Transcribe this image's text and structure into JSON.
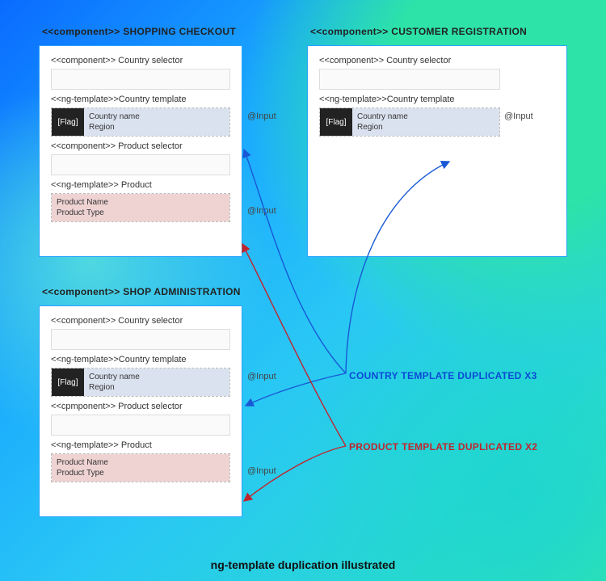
{
  "panels": {
    "p1": {
      "title": "<<component>> SHOPPING CHECKOUT",
      "country_selector_label": "<<component>> Country selector",
      "country_template_label": "<<ng-template>>Country template",
      "country_input_tag": "@Input",
      "flag_label": "[Flag]",
      "country_name": "Country name",
      "region": "Region",
      "product_selector_label": "<<component>> Product selector",
      "product_template_label": "<<ng-template>> Product",
      "product_input_tag": "@Input",
      "product_name": "Product Name",
      "product_type": "Product Type"
    },
    "p2": {
      "title": "<<component>> CUSTOMER REGISTRATION",
      "country_selector_label": "<<component>> Country selector",
      "country_template_label": "<<ng-template>>Country template",
      "country_input_tag": "@Input",
      "flag_label": "[Flag]",
      "country_name": "Country name",
      "region": "Region"
    },
    "p3": {
      "title": "<<component>> SHOP ADMINISTRATION",
      "country_selector_label": "<<component>> Country selector",
      "country_template_label": "<<ng-template>>Country template",
      "country_input_tag": "@Input",
      "flag_label": "[Flag]",
      "country_name": "Country name",
      "region": "Region",
      "product_selector_label": "<<cpmponent>> Product selector",
      "product_template_label": "<<ng-template>> Product",
      "product_input_tag": "@Input",
      "product_name": "Product Name",
      "product_type": "Product Type"
    }
  },
  "notes": {
    "country": "COUNTRY TEMPLATE DUPLICATED X3",
    "product": "PRODUCT TEMPLATE DUPLICATED X2"
  },
  "caption": "ng-template duplication illustrated"
}
